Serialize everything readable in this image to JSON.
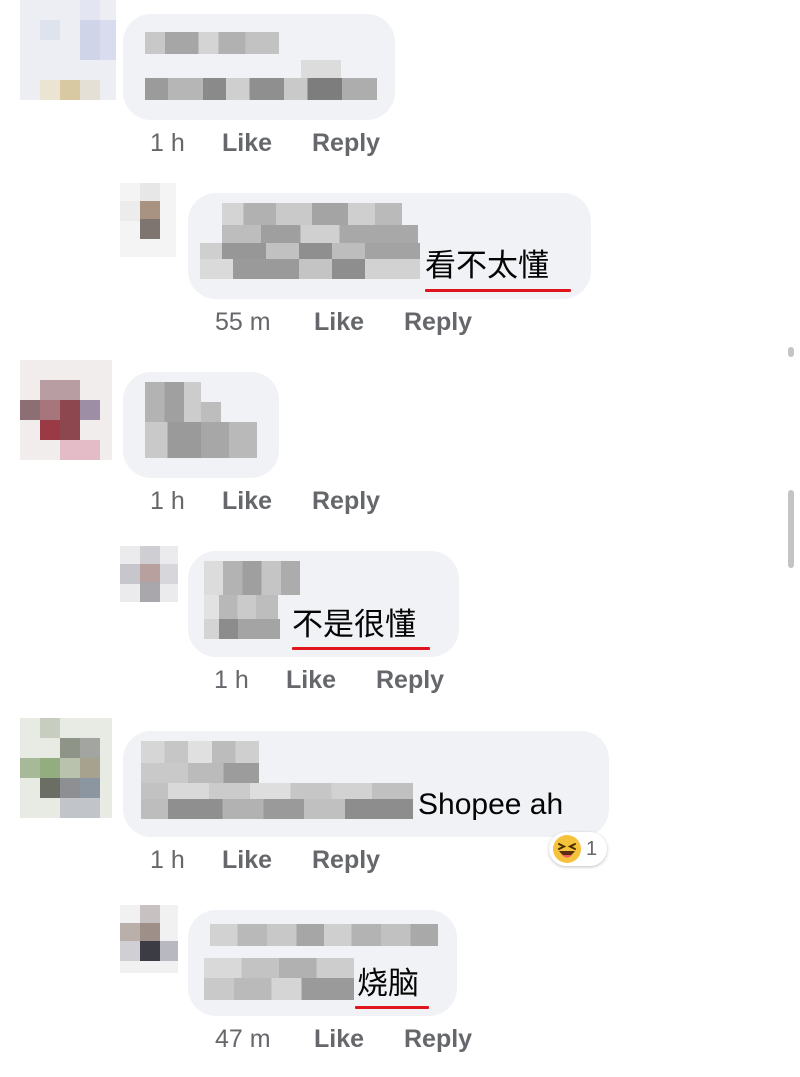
{
  "colors": {
    "bubble_bg": "#f0f2f5",
    "meta_text": "#65676b",
    "underline": "#e0141d",
    "reaction_face": "#f5c33b"
  },
  "comments": [
    {
      "time": "1 h",
      "like": "Like",
      "reply": "Reply",
      "text": ""
    },
    {
      "time": "55 m",
      "like": "Like",
      "reply": "Reply",
      "text": "看不太懂"
    },
    {
      "time": "1 h",
      "like": "Like",
      "reply": "Reply",
      "text": ""
    },
    {
      "time": "1 h",
      "like": "Like",
      "reply": "Reply",
      "text": "不是很懂"
    },
    {
      "time": "1 h",
      "like": "Like",
      "reply": "Reply",
      "text": "Shopee ah",
      "reaction": {
        "icon": "haha-reaction-icon",
        "count": "1"
      }
    },
    {
      "time": "47 m",
      "like": "Like",
      "reply": "Reply",
      "text": "烧脑"
    }
  ]
}
